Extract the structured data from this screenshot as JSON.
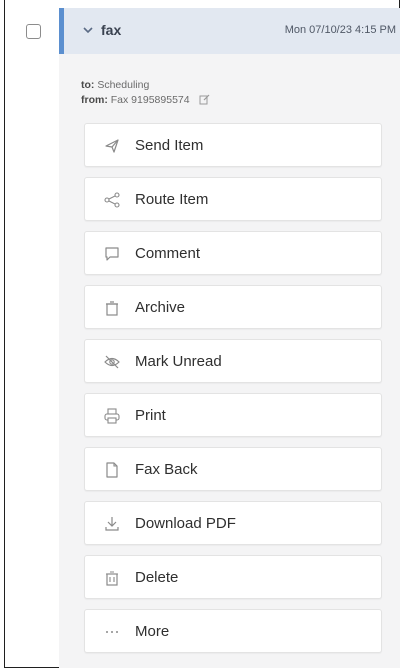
{
  "message": {
    "subject": "fax",
    "date": "Mon 07/10/23 4:15 PM",
    "to_label": "to:",
    "to_value": "Scheduling",
    "from_label": "from:",
    "from_value": "Fax 9195895574"
  },
  "actions": [
    {
      "label": "Send Item",
      "icon": "send-icon"
    },
    {
      "label": "Route Item",
      "icon": "share-icon"
    },
    {
      "label": "Comment",
      "icon": "comment-icon"
    },
    {
      "label": "Archive",
      "icon": "archive-icon"
    },
    {
      "label": "Mark Unread",
      "icon": "eye-off-icon"
    },
    {
      "label": "Print",
      "icon": "printer-icon"
    },
    {
      "label": "Fax Back",
      "icon": "document-icon"
    },
    {
      "label": "Download PDF",
      "icon": "download-icon"
    },
    {
      "label": "Delete",
      "icon": "trash-icon"
    },
    {
      "label": "More",
      "icon": "ellipsis-icon"
    }
  ],
  "colors": {
    "accent": "#5b8fcf",
    "header_bg": "#e2e8f1",
    "panel_bg": "#f4f4f5"
  }
}
